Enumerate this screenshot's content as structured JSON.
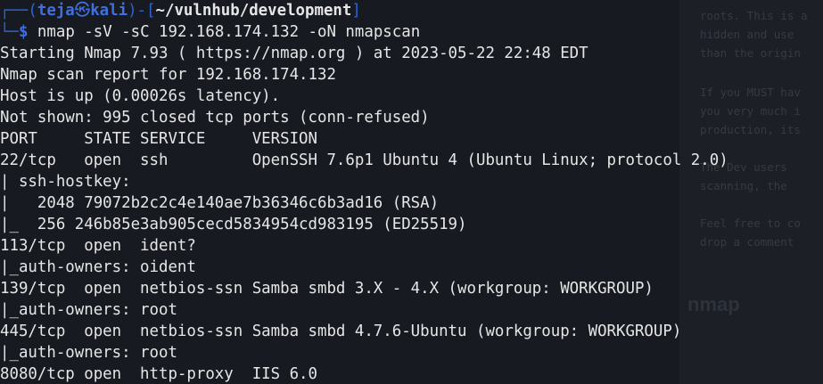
{
  "prompt": {
    "frame_open": "┌──(",
    "user": "teja",
    "symbol": "㉿",
    "host": "kali",
    "frame_mid": ")-[",
    "cwd": "~/vulnhub/development",
    "frame_close": "]",
    "prompt_prefix": "└─",
    "dollar": "$",
    "command": " nmap -sV -sC 192.168.174.132 -oN nmapscan"
  },
  "output": [
    "Starting Nmap 7.93 ( https://nmap.org ) at 2023-05-22 22:48 EDT",
    "Nmap scan report for 192.168.174.132",
    "Host is up (0.00026s latency).",
    "Not shown: 995 closed tcp ports (conn-refused)",
    "PORT     STATE SERVICE     VERSION",
    "22/tcp   open  ssh         OpenSSH 7.6p1 Ubuntu 4 (Ubuntu Linux; protocol 2.0)",
    "| ssh-hostkey:",
    "|   2048 79072b2c2c4e140ae7b36346c6b3ad16 (RSA)",
    "|_  256 246b85e3ab905cecd5834954cd983195 (ED25519)",
    "113/tcp  open  ident?",
    "|_auth-owners: oident",
    "139/tcp  open  netbios-ssn Samba smbd 3.X - 4.X (workgroup: WORKGROUP)",
    "|_auth-owners: root",
    "445/tcp  open  netbios-ssn Samba smbd 4.7.6-Ubuntu (workgroup: WORKGROUP)",
    "|_auth-owners: root",
    "8080/tcp open  http-proxy  IIS 6.0"
  ],
  "background_window": {
    "lines": [
      "roots. This is a",
      "hidden and use",
      "than the origin",
      "If you MUST hav",
      "you very much i",
      "production, its",
      "The Dev users",
      "scanning, the",
      "Feel free to co",
      "drop a comment"
    ],
    "heading": "nmap"
  }
}
